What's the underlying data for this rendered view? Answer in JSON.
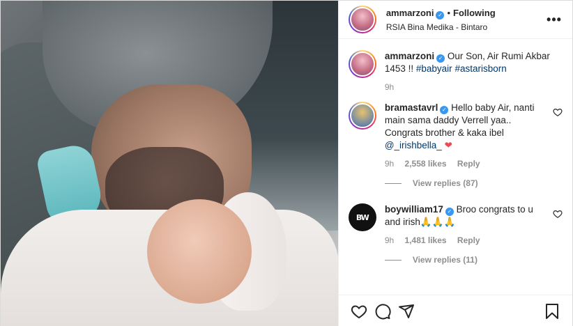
{
  "post": {
    "photo_alt": "",
    "author": {
      "username": "ammarzoni",
      "verified": true,
      "follow_status": "Following",
      "location": "RSIA Bina Medika - Bintaro"
    },
    "caption": {
      "username": "ammarzoni",
      "text": "Our Son, Air Rumi Akbar 1453 !!",
      "hashtags": [
        "#babyair",
        "#astarisborn"
      ],
      "time": "9h"
    },
    "comments": [
      {
        "username": "bramastavrl",
        "text": "Hello baby Air, nanti main sama daddy Verrell yaa.. Congrats brother & kaka ibel",
        "mention": "@_irishbella_",
        "emoji": "❤",
        "time": "9h",
        "likes": "2,558 likes",
        "reply_label": "Reply",
        "view_replies": "View replies (87)"
      },
      {
        "username": "boywilliam17",
        "avatar_text": "BW",
        "text": "Broo congrats to u and irish",
        "emoji": "🙏🙏🙏",
        "time": "9h",
        "likes": "1,481 likes",
        "reply_label": "Reply",
        "view_replies": "View replies (11)"
      }
    ],
    "more_label": "•••",
    "icons": [
      "heart-icon",
      "comment-icon",
      "share-icon",
      "bookmark-icon",
      "more-options-icon",
      "verified-badge-icon"
    ],
    "colors": {
      "link": "#00376b",
      "meta": "#8e8e8e",
      "verified": "#3897f0",
      "heart": "#ed4956"
    }
  }
}
